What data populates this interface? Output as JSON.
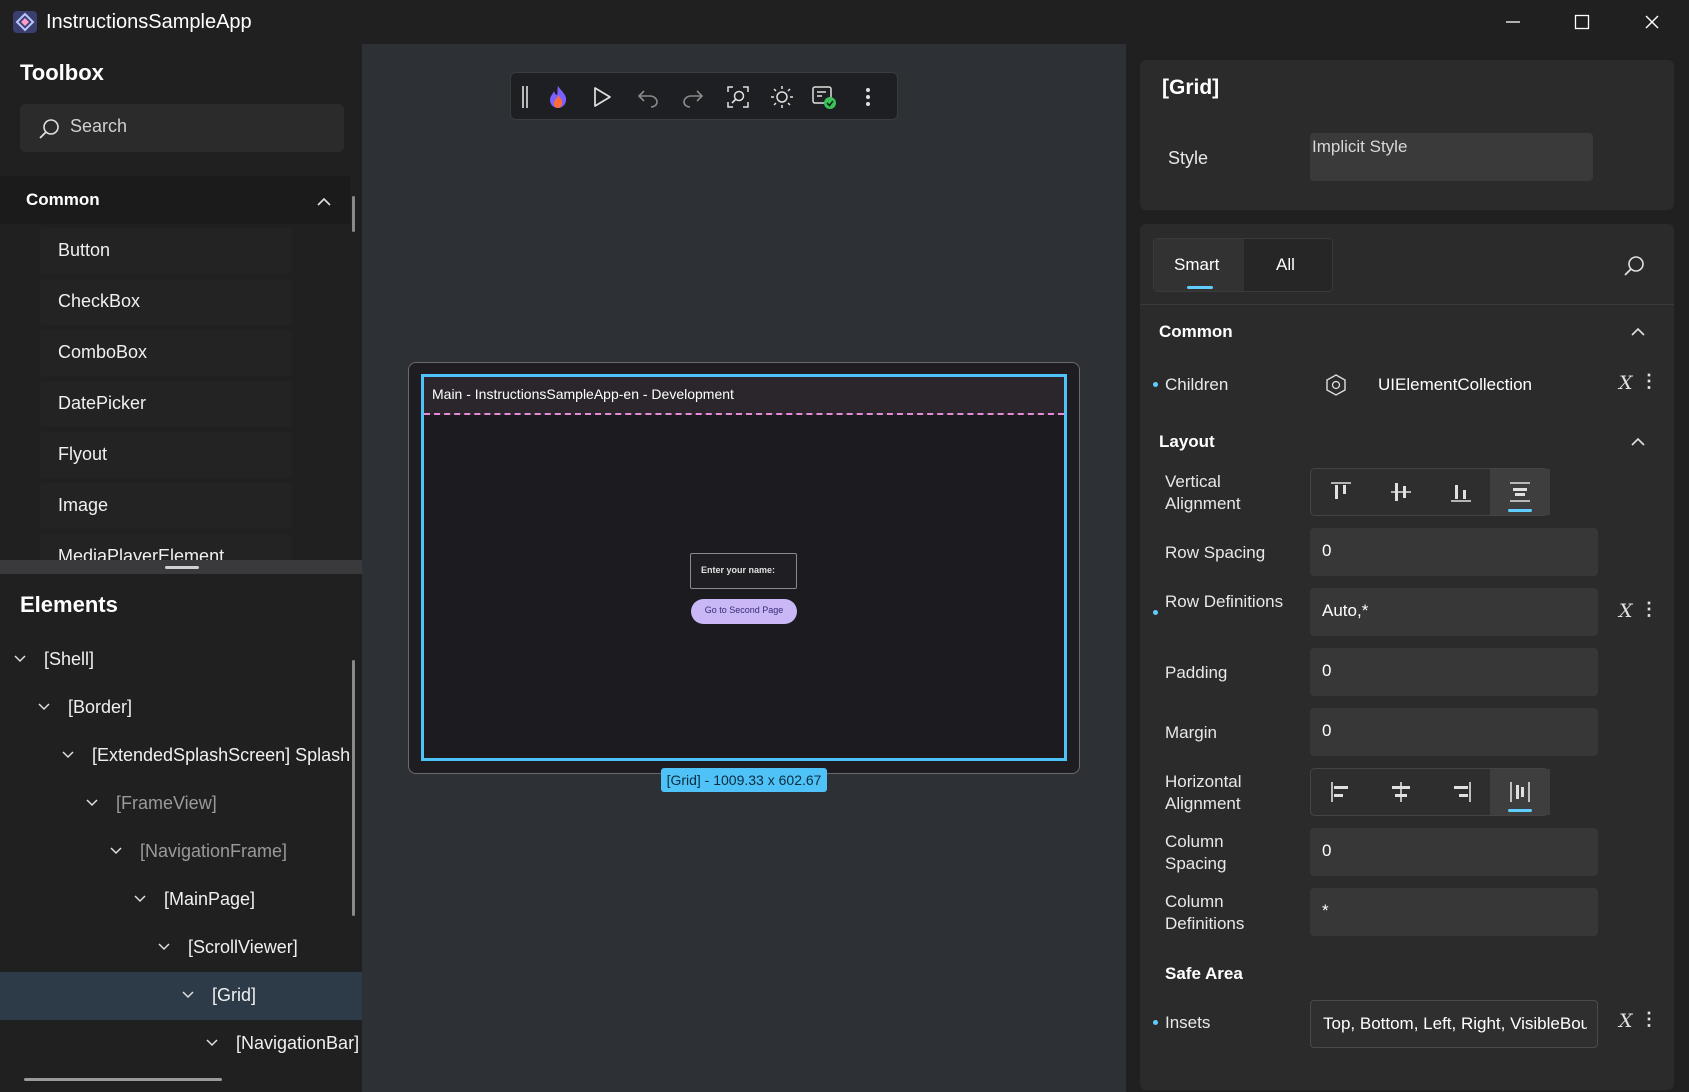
{
  "window": {
    "title": "InstructionsSampleApp",
    "minimize_icon": "minimize-icon",
    "maximize_icon": "maximize-icon",
    "close_icon": "close-icon"
  },
  "toolbox": {
    "title": "Toolbox",
    "search_placeholder": "Search",
    "common_label": "Common",
    "items": [
      "Button",
      "CheckBox",
      "ComboBox",
      "DatePicker",
      "Flyout",
      "Image",
      "MediaPlayerElement"
    ]
  },
  "elements": {
    "title": "Elements",
    "tree": [
      {
        "label": "[Shell]",
        "level": 0,
        "dim": false
      },
      {
        "label": "[Border]",
        "level": 1,
        "dim": false
      },
      {
        "label": "[ExtendedSplashScreen] Splash",
        "level": 2,
        "dim": false
      },
      {
        "label": "[FrameView]",
        "level": 3,
        "dim": true
      },
      {
        "label": "[NavigationFrame]",
        "level": 4,
        "dim": true
      },
      {
        "label": "[MainPage]",
        "level": 5,
        "dim": false
      },
      {
        "label": "[ScrollViewer]",
        "level": 6,
        "dim": false
      },
      {
        "label": "[Grid]",
        "level": 7,
        "dim": false,
        "selected": true
      },
      {
        "label": "[NavigationBar]",
        "level": 8,
        "dim": false
      }
    ]
  },
  "toolbar": {
    "icons": [
      "drag-handle-icon",
      "hot-reload-icon",
      "play-icon",
      "undo-icon",
      "redo-icon",
      "select-element-icon",
      "theme-icon",
      "status-check-icon",
      "more-options-icon"
    ]
  },
  "canvas": {
    "app_header_title": "Main - InstructionsSampleApp-en - Development",
    "name_input_label": "Enter your name:",
    "second_page_button": "Go to Second Page",
    "grid_badge": "[Grid] - 1009.33 x 602.67"
  },
  "properties": {
    "title": "[Grid]",
    "style_label": "Style",
    "style_value": "Implicit Style",
    "tabs": [
      "Smart",
      "All"
    ],
    "common_label": "Common",
    "children_label": "Children",
    "children_value": "UIElementCollection",
    "layout_label": "Layout",
    "vertical_alignment_label": "Vertical Alignment",
    "row_spacing_label": "Row Spacing",
    "row_spacing_value": "0",
    "row_definitions_label": "Row Definitions",
    "row_definitions_value": "Auto,*",
    "padding_label": "Padding",
    "padding_value": "0",
    "margin_label": "Margin",
    "margin_value": "0",
    "horizontal_alignment_label": "Horizontal Alignment",
    "column_spacing_label": "Column Spacing",
    "column_spacing_value": "0",
    "column_definitions_label": "Column Definitions",
    "column_definitions_value": "*",
    "safe_area_label": "Safe Area",
    "insets_label": "Insets",
    "insets_value": "Top, Bottom, Left, Right, VisibleBounds",
    "x_binding_glyph": "X",
    "more_glyph": "⋮"
  },
  "colors": {
    "accent": "#60cdff",
    "selection": "#4fc3f7",
    "button_fill": "#c9b8f5",
    "header_dash": "#e58ad6"
  }
}
